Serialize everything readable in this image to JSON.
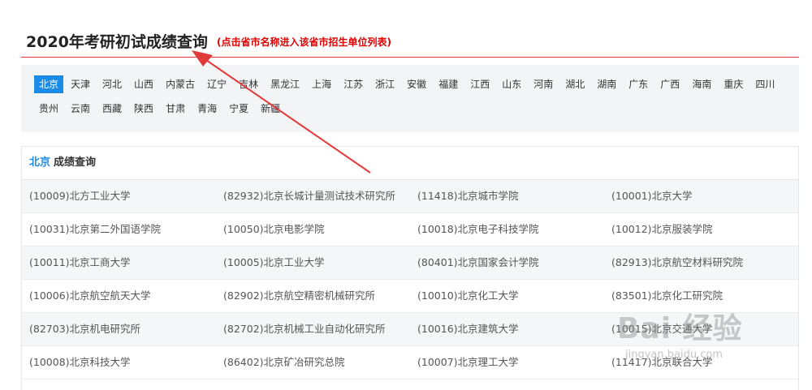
{
  "header": {
    "title": "2020年考研初试成绩查询",
    "hint": "(点击省市名称进入该省市招生单位列表)"
  },
  "provinces": {
    "active": "北京",
    "row1": [
      "北京",
      "天津",
      "河北",
      "山西",
      "内蒙古",
      "辽宁",
      "吉林",
      "黑龙江",
      "上海",
      "江苏",
      "浙江",
      "安徽",
      "福建",
      "江西",
      "山东",
      "河南",
      "湖北",
      "湖南",
      "广东",
      "广西",
      "海南",
      "重庆",
      "四川"
    ],
    "row2": [
      "贵州",
      "云南",
      "西藏",
      "陕西",
      "甘肃",
      "青海",
      "宁夏",
      "新疆"
    ]
  },
  "results": {
    "province": "北京",
    "heading": "成绩查询",
    "rows": [
      [
        "(10009)北方工业大学",
        "(82932)北京长城计量测试技术研究所",
        "(11418)北京城市学院",
        "(10001)北京大学"
      ],
      [
        "(10031)北京第二外国语学院",
        "(10050)北京电影学院",
        "(10018)北京电子科技学院",
        "(10012)北京服装学院"
      ],
      [
        "(10011)北京工商大学",
        "(10005)北京工业大学",
        "(80401)北京国家会计学院",
        "(82913)北京航空材料研究院"
      ],
      [
        "(10006)北京航空航天大学",
        "(82902)北京航空精密机械研究所",
        "(10010)北京化工大学",
        "(83501)北京化工研究院"
      ],
      [
        "(82703)北京机电研究所",
        "(82702)北京机械工业自动化研究所",
        "(10016)北京建筑大学",
        "(10015)北京交通大学"
      ],
      [
        "(10008)北京科技大学",
        "(86402)北京矿冶研究总院",
        "(10007)北京理工大学",
        "(11417)北京联合大学"
      ]
    ]
  },
  "watermark": {
    "logo": "Bai 经验",
    "url": "jingyan.baidu.com"
  },
  "colors": {
    "accent": "#1a8be6",
    "hint": "#e00000",
    "arrow": "#e23a3a"
  }
}
